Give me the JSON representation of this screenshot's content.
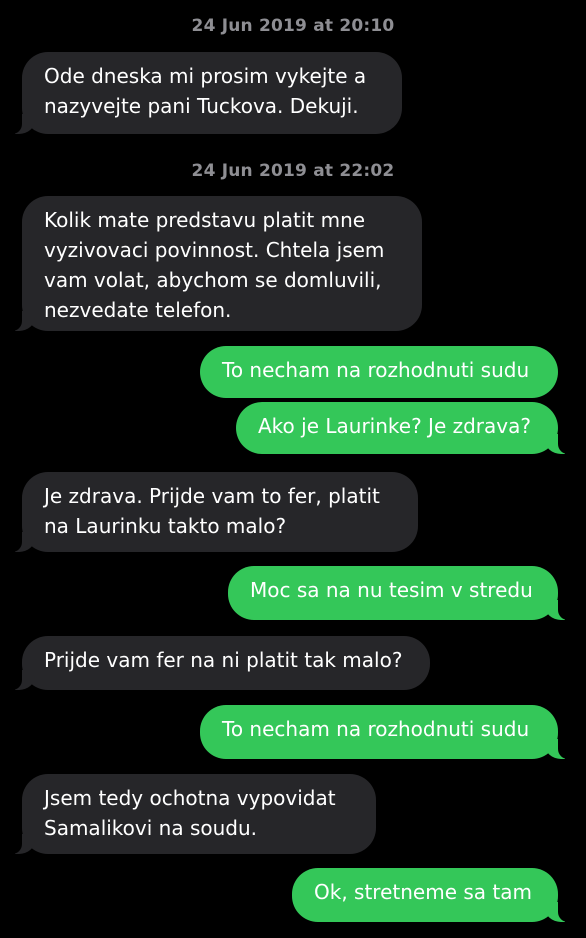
{
  "conversation": {
    "timestamps": [
      "24 Jun 2019 at 20:10",
      "24 Jun 2019 at 22:02"
    ],
    "messages": [
      {
        "direction": "received",
        "text": "Ode dneska mi prosim vykejte a\nnazyvejte pani Tuckova. Dekuji."
      },
      {
        "direction": "received",
        "text": "Kolik mate predstavu platit mne\nvyzivovaci povinnost. Chtela jsem\nvam volat, abychom se domluvili,\nnezvedate telefon."
      },
      {
        "direction": "sent",
        "text": "To necham na rozhodnuti sudu"
      },
      {
        "direction": "sent",
        "text": "Ako je Laurinke? Je zdrava?"
      },
      {
        "direction": "received",
        "text": "Je zdrava. Prijde vam to fer, platit\nna Laurinku takto malo?"
      },
      {
        "direction": "sent",
        "text": "Moc sa na nu tesim v stredu"
      },
      {
        "direction": "received",
        "text": "Prijde vam fer na ni platit tak malo?"
      },
      {
        "direction": "sent",
        "text": "To necham na rozhodnuti sudu"
      },
      {
        "direction": "received",
        "text": "Jsem tedy ochotna vypovidat\nSamalikovi na soudu."
      },
      {
        "direction": "sent",
        "text": "Ok, stretneme sa tam"
      }
    ]
  },
  "colors": {
    "background": "#000000",
    "received_bubble": "#262629",
    "sent_bubble": "#34c759",
    "timestamp_text": "#8e8e93"
  }
}
